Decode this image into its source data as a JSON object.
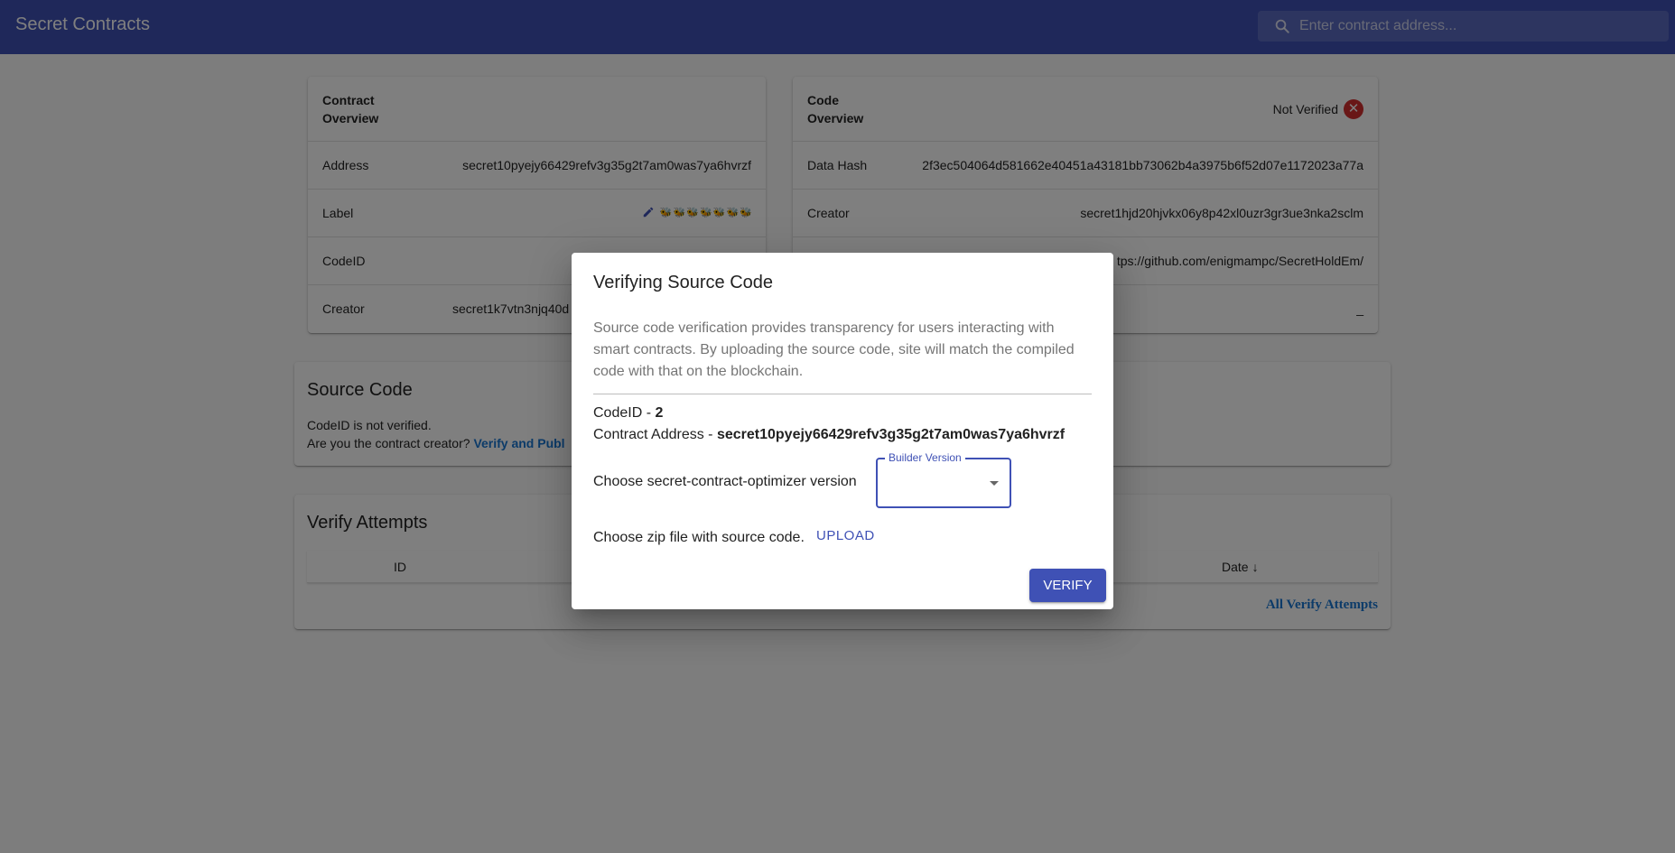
{
  "app": {
    "title": "Secret Contracts",
    "search_placeholder": "Enter contract address..."
  },
  "contract_overview": {
    "title": "Contract Overview",
    "rows": [
      {
        "key": "Address",
        "value": "secret10pyejy66429refv3g35g2t7am0was7ya6hvrzf"
      },
      {
        "key": "Label",
        "value": "🐝 🐝 🐝 🐝 🐝 🐝 🐝"
      },
      {
        "key": "CodeID",
        "value": ""
      },
      {
        "key": "Creator",
        "value": "secret1k7vtn3njq40d"
      }
    ],
    "edit_icon": "pencil-icon"
  },
  "code_overview": {
    "title": "Code Overview",
    "status": "Not Verified",
    "status_icon": "close-circle-icon",
    "rows": [
      {
        "key": "Data Hash",
        "value": "2f3ec504064d581662e40451a43181bb73062b4a3975b6f52d07e1172023a77a"
      },
      {
        "key": "Creator",
        "value": "secret1hjd20hjvkx06y8p42xl0uzr3gr3ue3nka2sclm"
      },
      {
        "key": "",
        "value": "tps://github.com/enigmampc/SecretHoldEm/"
      },
      {
        "key": "",
        "value": "_"
      }
    ]
  },
  "source_code": {
    "title": "Source Code",
    "not_verified_text": "CodeID is not verified.",
    "creator_question": "Are you the contract creator?",
    "verify_link": "Verify and Publ"
  },
  "verify_attempts": {
    "title": "Verify Attempts",
    "col_id": "ID",
    "col_date": "Date",
    "all_link": "All Verify Attempts"
  },
  "dialog": {
    "title": "Verifying Source Code",
    "description": "Source code verification provides transparency for users interacting with smart contracts. By uploading the source code, site will match the compiled code with that on the blockchain.",
    "codeid_label": "CodeID - ",
    "codeid_value": "2",
    "address_label": "Contract Address - ",
    "address_value": "secret10pyejy66429refv3g35g2t7am0was7ya6hvrzf",
    "optimizer_label": "Choose secret-contract-optimizer version",
    "builder_version_label": "Builder Version",
    "builder_version_value": "",
    "zip_label": "Choose zip file with source code.",
    "upload_label": "UPLOAD",
    "verify_label": "VERIFY"
  },
  "colors": {
    "primary": "#3f51b5",
    "error": "#d32f2f",
    "link": "#1976d2"
  }
}
